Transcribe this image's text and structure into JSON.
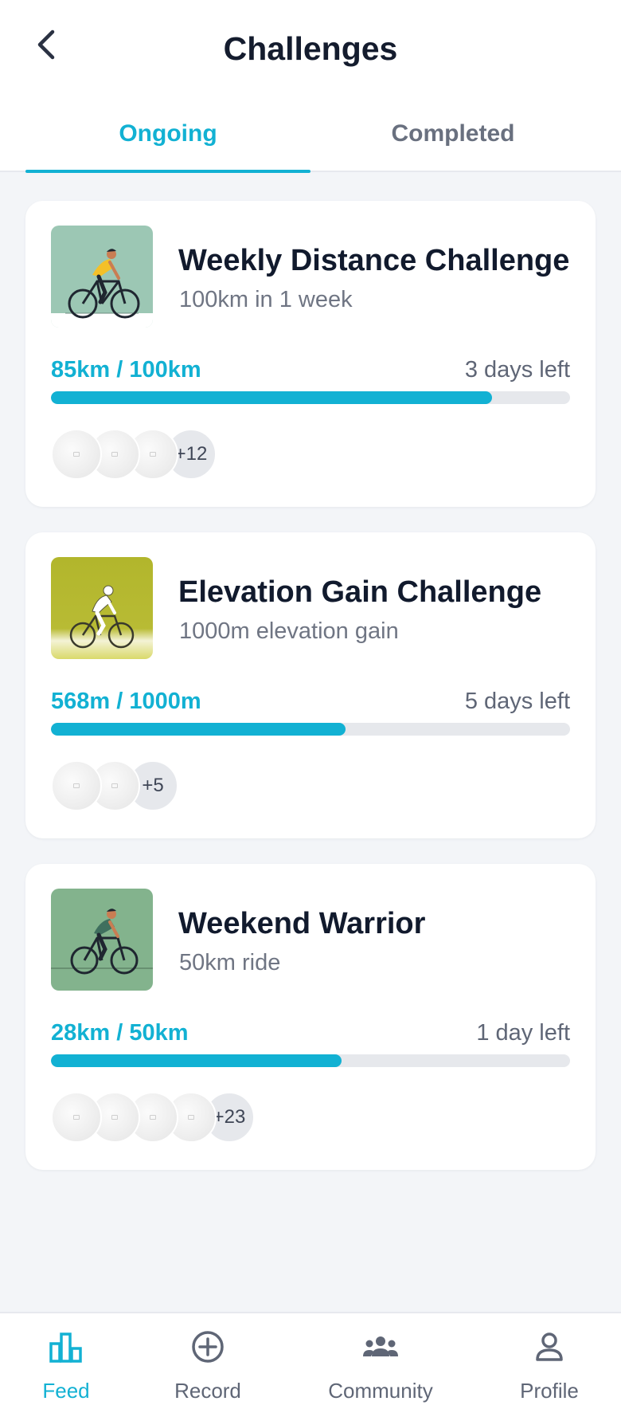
{
  "header": {
    "title": "Challenges",
    "back_icon": "chevron-left-icon"
  },
  "tabs": [
    {
      "label": "Ongoing",
      "active": true
    },
    {
      "label": "Completed",
      "active": false
    }
  ],
  "colors": {
    "accent": "#12b1d3",
    "text_primary": "#111a2d",
    "text_secondary": "#6f7583",
    "track": "#e6e8ec",
    "background": "#f3f5f8"
  },
  "challenges": [
    {
      "title": "Weekly Distance Challenge",
      "subtitle": "100km in 1 week",
      "progress_text": "85km / 100km",
      "time_left": "3 days left",
      "progress": 0.85,
      "avatar_count": 3,
      "more": "+12",
      "thumb_bg": "#9cc7b4"
    },
    {
      "title": "Elevation Gain Challenge",
      "subtitle": "1000m elevation gain",
      "progress_text": "568m / 1000m",
      "time_left": "5 days left",
      "progress": 0.568,
      "avatar_count": 2,
      "more": "+5",
      "thumb_bg": "#b5b92f"
    },
    {
      "title": "Weekend Warrior",
      "subtitle": "50km ride",
      "progress_text": "28km / 50km",
      "time_left": "1 day left",
      "progress": 0.56,
      "avatar_count": 4,
      "more": "+23",
      "thumb_bg": "#83b38d"
    }
  ],
  "bottom_nav": [
    {
      "label": "Feed",
      "icon": "bar-chart-icon",
      "active": true
    },
    {
      "label": "Record",
      "icon": "plus-circle-icon",
      "active": false
    },
    {
      "label": "Community",
      "icon": "group-icon",
      "active": false
    },
    {
      "label": "Profile",
      "icon": "person-icon",
      "active": false
    }
  ]
}
